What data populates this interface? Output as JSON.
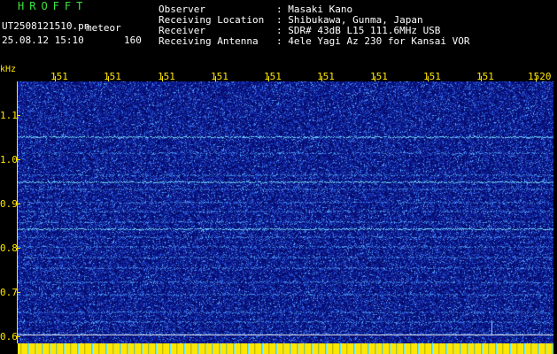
{
  "header": {
    "brand": "HROFFT",
    "filename": "UT2508121510.pn",
    "filename_suffix": "meteor",
    "timestamp": "25.08.12 15:10",
    "count": "160",
    "info": [
      {
        "label": "Observer",
        "value": ": Masaki Kano"
      },
      {
        "label": "Receiving Location",
        "value": ": Shibukawa, Gunma, Japan"
      },
      {
        "label": "Receiver",
        "value": ": SDR# 43dB L15 111.6MHz USB"
      },
      {
        "label": "Receiving Antenna",
        "value": ": 4ele Yagi Az 230 for Kansai VOR"
      }
    ]
  },
  "axis": {
    "y_unit": "kHz",
    "y_ticks": [
      "1.1",
      "1.0",
      "0.9",
      "0.8",
      "0.7",
      "0.6"
    ],
    "x_ticks": [
      "151",
      "151",
      "151",
      "151",
      "151",
      "151",
      "151",
      "151",
      "151",
      "1520"
    ]
  },
  "colors": {
    "background": "#050a6e",
    "band": "#7fd8ff",
    "axis": "#ffe600",
    "brand": "#3ee63e"
  }
}
